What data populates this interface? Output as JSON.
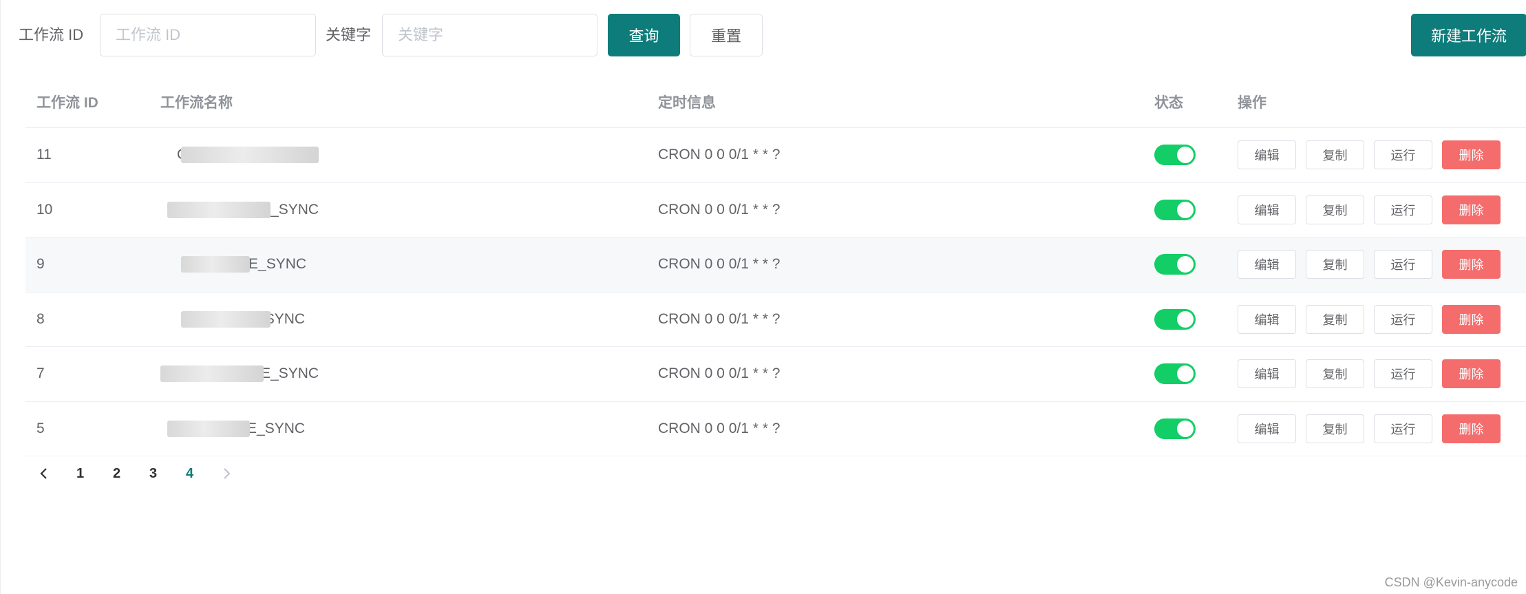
{
  "filters": {
    "id_label": "工作流 ID",
    "id_placeholder": "工作流 ID",
    "keyword_label": "关键字",
    "keyword_placeholder": "关键字",
    "query_button": "查询",
    "reset_button": "重置",
    "create_button": "新建工作流"
  },
  "table": {
    "columns": [
      "工作流 ID",
      "工作流名称",
      "定时信息",
      "状态",
      "操作"
    ],
    "rows": [
      {
        "id": "11",
        "name": "C_FILE_SYNC",
        "cron": "CRON 0 0 0/1 * * ?",
        "enabled": true
      },
      {
        "id": "10",
        "name": "_FILE_SYNC",
        "cron": "CRON 0 0 0/1 * * ?",
        "enabled": true
      },
      {
        "id": "9",
        "name": "_FILE_SYNC",
        "cron": "CRON 0 0 0/1 * * ?",
        "enabled": true
      },
      {
        "id": "8",
        "name": "_FILE_SYNC",
        "cron": "CRON 0 0 0/1 * * ?",
        "enabled": true
      },
      {
        "id": "7",
        "name": "_FILE_SYNC",
        "cron": "CRON 0 0 0/1 * * ?",
        "enabled": true
      },
      {
        "id": "5",
        "name": "_FILE_SYNC",
        "cron": "CRON 0 0 0/1 * * ?",
        "enabled": true
      }
    ],
    "actions": {
      "edit": "编辑",
      "copy": "复制",
      "run": "运行",
      "delete": "删除"
    }
  },
  "pagination": {
    "pages": [
      "1",
      "2",
      "3",
      "4"
    ],
    "current": "4",
    "prev_icon": "chevron-left-icon",
    "next_icon": "chevron-right-icon"
  },
  "watermark": "CSDN @Kevin-anycode",
  "colors": {
    "primary": "#0e7c7b",
    "switch_on": "#13ce66",
    "danger": "#f56c6c"
  }
}
